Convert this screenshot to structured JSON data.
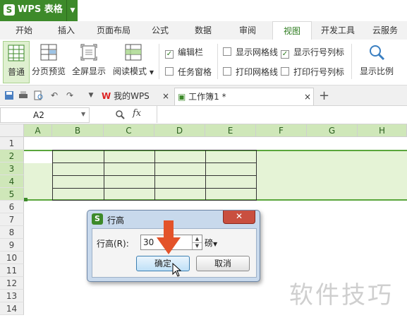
{
  "app": {
    "title": "WPS 表格",
    "logo_letter": "S"
  },
  "ribbon_tabs": [
    "开始",
    "插入",
    "页面布局",
    "公式",
    "数据",
    "审阅",
    "视图",
    "开发工具",
    "云服务"
  ],
  "active_tab": "视图",
  "ribbon": {
    "normal": "普通",
    "page_break_preview": "分页预览",
    "full_screen": "全屏显示",
    "reading_mode": "阅读模式",
    "edit_bar": {
      "label": "编辑栏",
      "checked": true
    },
    "task_pane": {
      "label": "任务窗格",
      "checked": false
    },
    "show_gridlines": {
      "label": "显示网格线",
      "checked": false
    },
    "print_gridlines": {
      "label": "打印网格线",
      "checked": false
    },
    "show_row_col_headers": {
      "label": "显示行号列标",
      "checked": true
    },
    "print_row_col_headers": {
      "label": "打印行号列标",
      "checked": false
    },
    "zoom": "显示比例"
  },
  "doc_tabs": {
    "my_wps": "我的WPS",
    "workbook": "工作簿1 *",
    "add": "+"
  },
  "formula_bar": {
    "cell_ref": "A2",
    "fx": "fx"
  },
  "columns": [
    "A",
    "B",
    "C",
    "D",
    "E",
    "F",
    "G",
    "H"
  ],
  "rows": [
    "1",
    "2",
    "3",
    "4",
    "5",
    "6",
    "7",
    "8",
    "9",
    "10",
    "11",
    "12",
    "13",
    "14"
  ],
  "dialog": {
    "title": "行高",
    "field_label": "行高(R):",
    "value": "30",
    "unit": "磅",
    "ok": "确定",
    "cancel": "取消"
  },
  "watermark": "软件技巧",
  "colors": {
    "brand_green": "#3d8a2a",
    "selection_fill": "#e5f3d6",
    "selection_border": "#5aa63c",
    "arrow": "#e3532a"
  }
}
